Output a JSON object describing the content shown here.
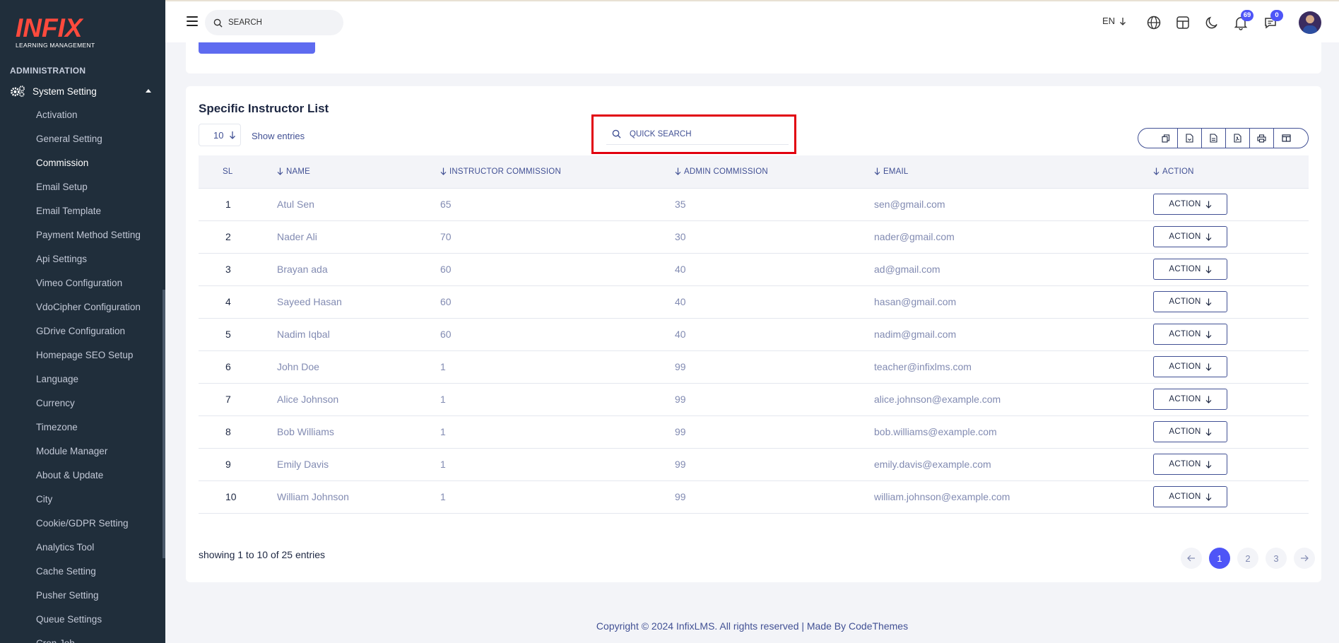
{
  "brand": {
    "logo_text": "INFIX",
    "logo_sub": "LEARNING MANAGEMENT"
  },
  "sidebar": {
    "section_title": "ADMINISTRATION",
    "parent_label": "System Setting",
    "items": [
      {
        "label": "Activation"
      },
      {
        "label": "General Setting"
      },
      {
        "label": "Commission",
        "active": true
      },
      {
        "label": "Email Setup"
      },
      {
        "label": "Email Template"
      },
      {
        "label": "Payment Method Setting"
      },
      {
        "label": "Api Settings"
      },
      {
        "label": "Vimeo Configuration"
      },
      {
        "label": "VdoCipher Configuration"
      },
      {
        "label": "GDrive Configuration"
      },
      {
        "label": "Homepage SEO Setup"
      },
      {
        "label": "Language"
      },
      {
        "label": "Currency"
      },
      {
        "label": "Timezone"
      },
      {
        "label": "Module Manager"
      },
      {
        "label": "About & Update"
      },
      {
        "label": "City"
      },
      {
        "label": "Cookie/GDPR Setting"
      },
      {
        "label": "Analytics Tool"
      },
      {
        "label": "Cache Setting"
      },
      {
        "label": "Pusher Setting"
      },
      {
        "label": "Queue Settings"
      },
      {
        "label": "Cron Job"
      }
    ]
  },
  "header": {
    "search_placeholder": "SEARCH",
    "language": "EN",
    "notifications_count": "69",
    "messages_count": "0",
    "icons": [
      "globe-icon",
      "layout-icon",
      "moon-icon",
      "bell-icon",
      "chat-icon"
    ]
  },
  "list": {
    "title": "Specific Instructor List",
    "page_size": "10",
    "show_entries_label": "Show entries",
    "quick_search_placeholder": "QUICK SEARCH",
    "export_icons": [
      "copy-icon",
      "csv-icon",
      "excel-icon",
      "pdf-icon",
      "print-icon",
      "columns-icon"
    ],
    "columns": [
      "SL",
      "NAME",
      "INSTRUCTOR COMMISSION",
      "ADMIN COMMISSION",
      "EMAIL",
      "ACTION"
    ],
    "rows": [
      {
        "sl": "1",
        "name": "Atul Sen",
        "instructor": "65",
        "admin": "35",
        "email": "sen@gmail.com",
        "action": "ACTION"
      },
      {
        "sl": "2",
        "name": "Nader Ali",
        "instructor": "70",
        "admin": "30",
        "email": "nader@gmail.com",
        "action": "ACTION"
      },
      {
        "sl": "3",
        "name": "Brayan ada",
        "instructor": "60",
        "admin": "40",
        "email": "ad@gmail.com",
        "action": "ACTION"
      },
      {
        "sl": "4",
        "name": "Sayeed Hasan",
        "instructor": "60",
        "admin": "40",
        "email": "hasan@gmail.com",
        "action": "ACTION"
      },
      {
        "sl": "5",
        "name": "Nadim Iqbal",
        "instructor": "60",
        "admin": "40",
        "email": "nadim@gmail.com",
        "action": "ACTION"
      },
      {
        "sl": "6",
        "name": "John Doe",
        "instructor": "1",
        "admin": "99",
        "email": "teacher@infixlms.com",
        "action": "ACTION"
      },
      {
        "sl": "7",
        "name": "Alice Johnson",
        "instructor": "1",
        "admin": "99",
        "email": "alice.johnson@example.com",
        "action": "ACTION"
      },
      {
        "sl": "8",
        "name": "Bob Williams",
        "instructor": "1",
        "admin": "99",
        "email": "bob.williams@example.com",
        "action": "ACTION"
      },
      {
        "sl": "9",
        "name": "Emily Davis",
        "instructor": "1",
        "admin": "99",
        "email": "emily.davis@example.com",
        "action": "ACTION"
      },
      {
        "sl": "10",
        "name": "William Johnson",
        "instructor": "1",
        "admin": "99",
        "email": "william.johnson@example.com",
        "action": "ACTION"
      }
    ],
    "showing_text": "showing 1 to 10 of 25 entries",
    "pages": [
      "1",
      "2",
      "3"
    ],
    "current_page": "1"
  },
  "footer": {
    "text": "Copyright © 2024 InfixLMS. All rights reserved | Made By CodeThemes"
  },
  "colors": {
    "accent": "#4e55f7",
    "sidebar_bg": "#202e3b",
    "highlight": "#e1000f",
    "text_primary": "#415094"
  }
}
